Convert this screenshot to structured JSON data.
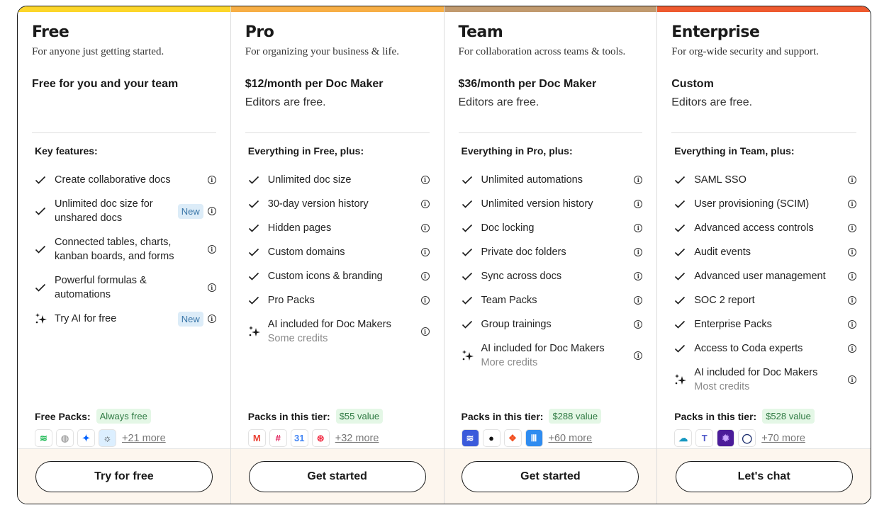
{
  "tiers": [
    {
      "name": "Free",
      "tagline": "For anyone just getting started.",
      "price": "Free for you and your team",
      "price_sub": "",
      "accent": "#fcd62a",
      "features_heading": "Key features:",
      "features": [
        {
          "icon": "check",
          "text": "Create collaborative docs",
          "sub": "",
          "badge": ""
        },
        {
          "icon": "check",
          "text": "Unlimited doc size for unshared docs",
          "sub": "",
          "badge": "New"
        },
        {
          "icon": "check",
          "text": "Connected tables, charts, kanban boards, and forms",
          "sub": "",
          "badge": ""
        },
        {
          "icon": "check",
          "text": "Powerful formulas & automations",
          "sub": "",
          "badge": ""
        },
        {
          "icon": "sparkle",
          "text": "Try AI for free",
          "sub": "",
          "badge": "New"
        }
      ],
      "packs_label": "Free Packs:",
      "packs_value": "Always free",
      "packs": [
        {
          "name": "spotify-icon",
          "glyph": "≋",
          "color": "#1db954",
          "bg": "#fff"
        },
        {
          "name": "wikipedia-icon",
          "glyph": "◍",
          "color": "#aaaaaa",
          "bg": "#fff"
        },
        {
          "name": "dropbox-icon",
          "glyph": "✦",
          "color": "#0061fe",
          "bg": "#fff"
        },
        {
          "name": "weather-icon",
          "glyph": "☼",
          "color": "#1a1a1a",
          "bg": "#dcefff"
        }
      ],
      "more": "+21 more",
      "cta": "Try for free"
    },
    {
      "name": "Pro",
      "tagline": "For organizing your business & life.",
      "price": "$12/month per Doc Maker",
      "price_sub": "Editors are free.",
      "accent": "#f7ae45",
      "features_heading": "Everything in Free, plus:",
      "features": [
        {
          "icon": "check",
          "text": "Unlimited doc size",
          "sub": "",
          "badge": ""
        },
        {
          "icon": "check",
          "text": "30-day version history",
          "sub": "",
          "badge": ""
        },
        {
          "icon": "check",
          "text": "Hidden pages",
          "sub": "",
          "badge": ""
        },
        {
          "icon": "check",
          "text": "Custom domains",
          "sub": "",
          "badge": ""
        },
        {
          "icon": "check",
          "text": "Custom icons & branding",
          "sub": "",
          "badge": ""
        },
        {
          "icon": "check",
          "text": "Pro Packs",
          "sub": "",
          "badge": ""
        },
        {
          "icon": "sparkle",
          "text": "AI included for Doc Makers",
          "sub": "Some credits",
          "badge": ""
        }
      ],
      "packs_label": "Packs in this tier:",
      "packs_value": "$55 value",
      "packs": [
        {
          "name": "gmail-icon",
          "glyph": "M",
          "color": "#ea4335",
          "bg": "#fff"
        },
        {
          "name": "slack-icon",
          "glyph": "#",
          "color": "#e01e5a",
          "bg": "#fff"
        },
        {
          "name": "google-calendar-icon",
          "glyph": "31",
          "color": "#4285f4",
          "bg": "#fff"
        },
        {
          "name": "twilio-icon",
          "glyph": "⊛",
          "color": "#f22f46",
          "bg": "#fff"
        }
      ],
      "more": "+32 more",
      "cta": "Get started"
    },
    {
      "name": "Team",
      "tagline": "For collaboration across teams & tools.",
      "price": "$36/month per Doc Maker",
      "price_sub": "Editors are free.",
      "accent": "#c19a6e",
      "features_heading": "Everything in Pro, plus:",
      "features": [
        {
          "icon": "check",
          "text": "Unlimited automations",
          "sub": "",
          "badge": ""
        },
        {
          "icon": "check",
          "text": "Unlimited version history",
          "sub": "",
          "badge": ""
        },
        {
          "icon": "check",
          "text": "Doc locking",
          "sub": "",
          "badge": ""
        },
        {
          "icon": "check",
          "text": "Private doc folders",
          "sub": "",
          "badge": ""
        },
        {
          "icon": "check",
          "text": "Sync across docs",
          "sub": "",
          "badge": ""
        },
        {
          "icon": "check",
          "text": "Team Packs",
          "sub": "",
          "badge": ""
        },
        {
          "icon": "check",
          "text": "Group trainings",
          "sub": "",
          "badge": ""
        },
        {
          "icon": "sparkle",
          "text": "AI included for Doc Makers",
          "sub": "More credits",
          "badge": ""
        }
      ],
      "packs_label": "Packs in this tier:",
      "packs_value": "$288 value",
      "packs": [
        {
          "name": "jira-icon",
          "glyph": "≋",
          "color": "#ffffff",
          "bg": "#3b5bdb"
        },
        {
          "name": "github-icon",
          "glyph": "●",
          "color": "#111111",
          "bg": "#fff"
        },
        {
          "name": "figma-icon",
          "glyph": "❖",
          "color": "#f24e1e",
          "bg": "#fff"
        },
        {
          "name": "intercom-icon",
          "glyph": "Ⅲ",
          "color": "#ffffff",
          "bg": "#2f8cf0"
        }
      ],
      "more": "+60 more",
      "cta": "Get started"
    },
    {
      "name": "Enterprise",
      "tagline": "For org-wide security and support.",
      "price": "Custom",
      "price_sub": "Editors are free.",
      "accent": "#ee5a2f",
      "features_heading": "Everything in Team, plus:",
      "features": [
        {
          "icon": "check",
          "text": "SAML SSO",
          "sub": "",
          "badge": ""
        },
        {
          "icon": "check",
          "text": "User provisioning (SCIM)",
          "sub": "",
          "badge": ""
        },
        {
          "icon": "check",
          "text": "Advanced access controls",
          "sub": "",
          "badge": ""
        },
        {
          "icon": "check",
          "text": "Audit events",
          "sub": "",
          "badge": ""
        },
        {
          "icon": "check",
          "text": "Advanced user management",
          "sub": "",
          "badge": ""
        },
        {
          "icon": "check",
          "text": "SOC 2 report",
          "sub": "",
          "badge": ""
        },
        {
          "icon": "check",
          "text": "Enterprise Packs",
          "sub": "",
          "badge": ""
        },
        {
          "icon": "check",
          "text": "Access to Coda experts",
          "sub": "",
          "badge": ""
        },
        {
          "icon": "sparkle",
          "text": "AI included for Doc Makers",
          "sub": "Most credits",
          "badge": ""
        }
      ],
      "packs_label": "Packs in this tier:",
      "packs_value": "$528 value",
      "packs": [
        {
          "name": "salesforce-icon",
          "glyph": "☁",
          "color": "#1798c1",
          "bg": "#fff"
        },
        {
          "name": "microsoft-teams-icon",
          "glyph": "T",
          "color": "#5059c9",
          "bg": "#fff"
        },
        {
          "name": "heap-icon",
          "glyph": "✹",
          "color": "#c9a6ff",
          "bg": "#4b1c9a"
        },
        {
          "name": "okta-icon",
          "glyph": "◯",
          "color": "#1d2f6f",
          "bg": "#fff"
        }
      ],
      "more": "+70 more",
      "cta": "Let's chat"
    }
  ]
}
